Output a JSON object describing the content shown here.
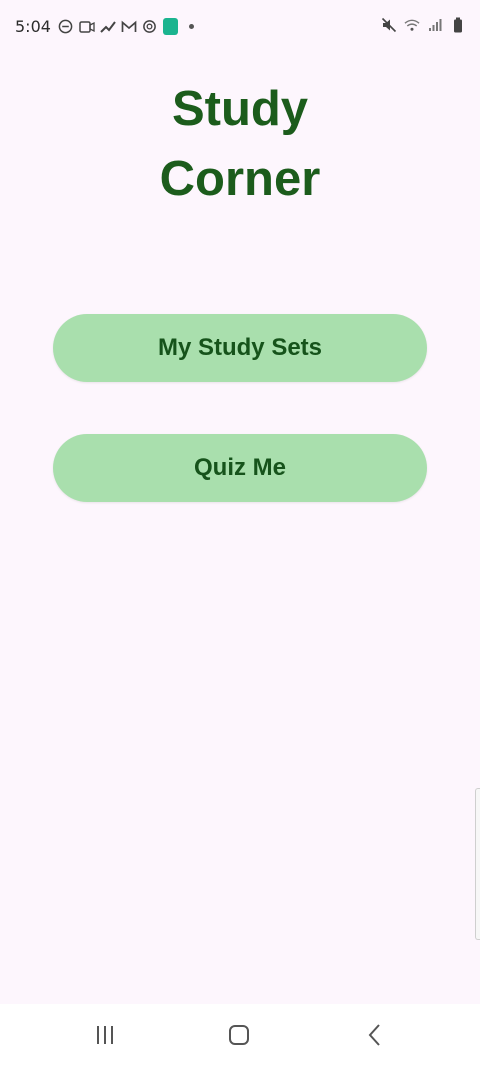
{
  "status_bar": {
    "time": "5:04",
    "left_icons": [
      "do-not-disturb-icon",
      "video-icon",
      "signal-tool-icon",
      "gmail-icon",
      "sync-icon",
      "app-badge-icon",
      "dot-icon"
    ],
    "right_icons": [
      "mute-icon",
      "wifi-icon",
      "signal-bars-icon",
      "battery-icon"
    ]
  },
  "main": {
    "title_line1": "Study",
    "title_line2": "Corner",
    "buttons": [
      {
        "label": "My Study Sets"
      },
      {
        "label": "Quiz Me"
      }
    ]
  },
  "nav_bar": {
    "recents_icon": "recents-icon",
    "home_icon": "home-icon",
    "back_icon": "back-icon"
  },
  "colors": {
    "background": "#fdf6fd",
    "title": "#1c5c1c",
    "button_bg": "#a9dfad",
    "button_text": "#16531b"
  }
}
